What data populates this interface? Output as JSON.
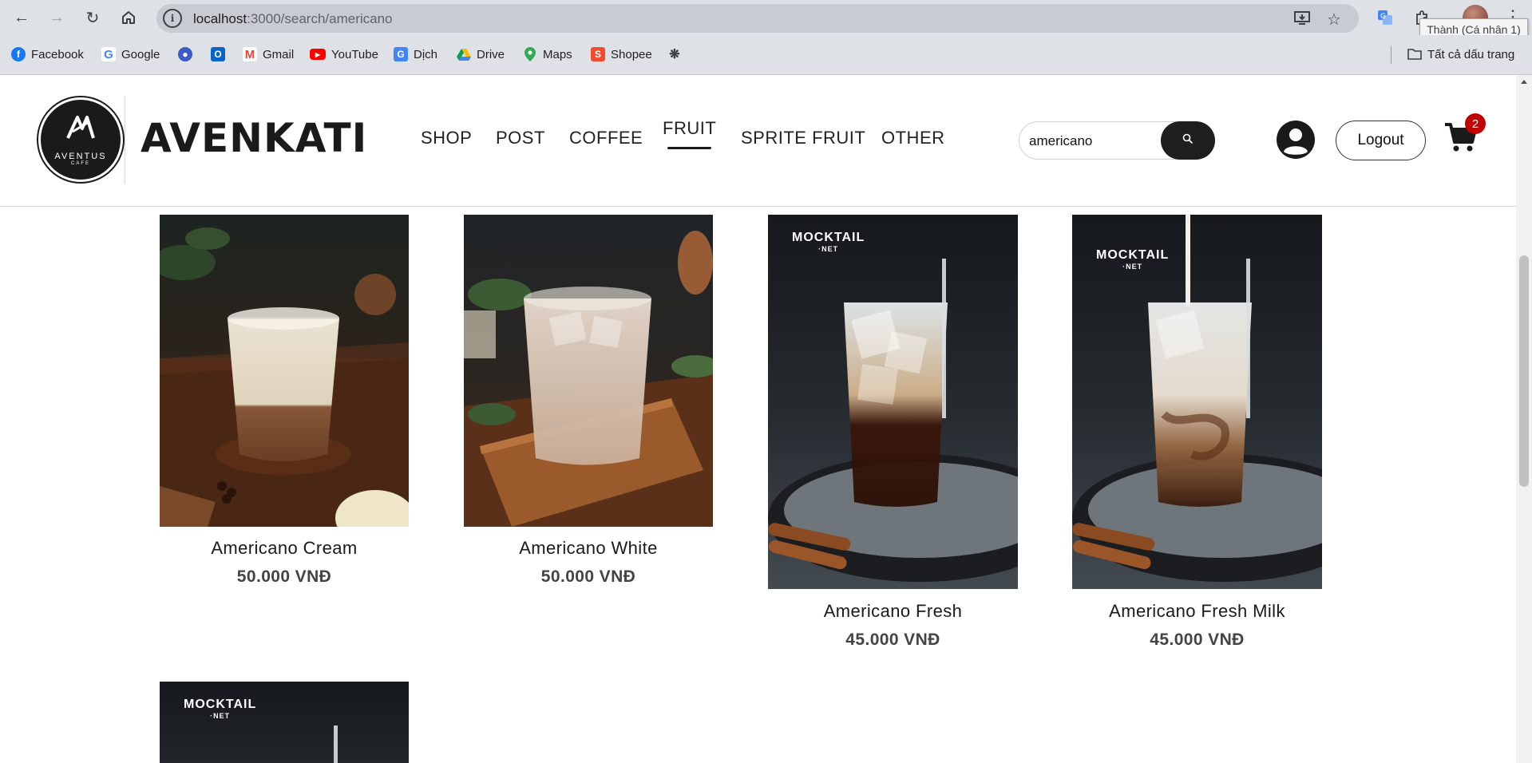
{
  "browser": {
    "url_host": "localhost",
    "url_path": ":3000/search/americano",
    "profile_tooltip": "Thành (Cá nhân 1)",
    "bookmarks": [
      {
        "label": "Facebook",
        "icon": "facebook-icon",
        "color": "#1877f2"
      },
      {
        "label": "Google",
        "icon": "google-icon",
        "color": "#4285f4"
      },
      {
        "label": "",
        "icon": "app-icon-1",
        "color": "#3b5cc8"
      },
      {
        "label": "",
        "icon": "outlook-icon",
        "color": "#0a64c8"
      },
      {
        "label": "Gmail",
        "icon": "gmail-icon",
        "color": "#ea4335"
      },
      {
        "label": "YouTube",
        "icon": "youtube-icon",
        "color": "#ff0000"
      },
      {
        "label": "Dịch",
        "icon": "translate-icon",
        "color": "#4285f4"
      },
      {
        "label": "Drive",
        "icon": "drive-icon",
        "color": "#0f9d58"
      },
      {
        "label": "Maps",
        "icon": "maps-icon",
        "color": "#34a853"
      },
      {
        "label": "Shopee",
        "icon": "shopee-icon",
        "color": "#ee4d2d"
      },
      {
        "label": "",
        "icon": "openai-icon",
        "color": "#3c4043"
      }
    ],
    "all_bookmarks": "Tất cả dấu trang"
  },
  "site": {
    "logo_name": "AVENTUS",
    "logo_sub": "CAFE",
    "brand": "AVENKATI",
    "menu": [
      "SHOP",
      "POST",
      "COFFEE",
      "FRUIT",
      "SPRITE FRUIT",
      "OTHER"
    ],
    "active_menu": "FRUIT",
    "search_value": "americano",
    "logout_label": "Logout",
    "cart_count": "2"
  },
  "products": [
    {
      "name": "Americano Cream",
      "price": "50.000 VNĐ",
      "style": "cream"
    },
    {
      "name": "Americano White",
      "price": "50.000 VNĐ",
      "style": "white"
    },
    {
      "name": "Americano Fresh",
      "price": "45.000 VNĐ",
      "style": "fresh"
    },
    {
      "name": "Americano Fresh Milk",
      "price": "45.000 VNĐ",
      "style": "freshmilk"
    }
  ],
  "image_watermark": {
    "line1": "MOCKTAIL",
    "line2": "·NET"
  },
  "colors": {
    "badge": "#c00000",
    "dark": "#1f1f1f",
    "chrome": "#dee1e6"
  }
}
